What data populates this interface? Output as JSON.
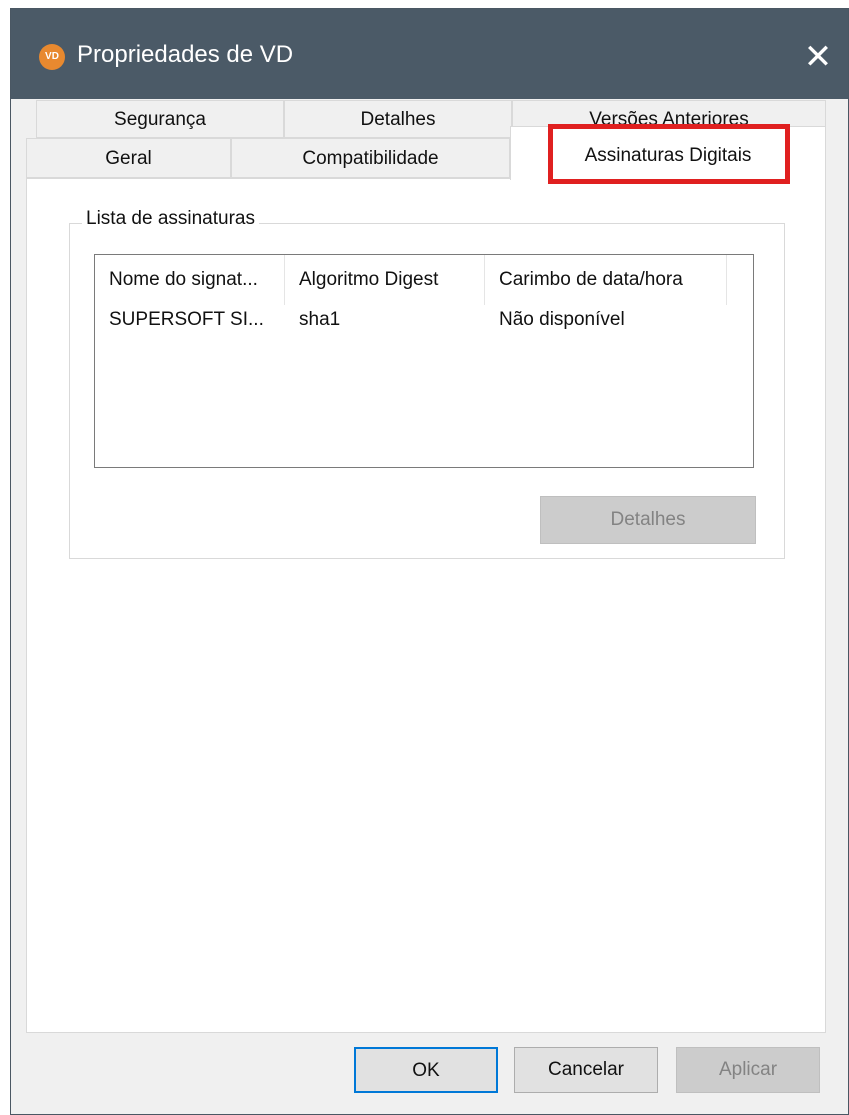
{
  "window": {
    "title": "Propriedades de VD",
    "icon_text": "VD",
    "close_glyph": "✕"
  },
  "tabs": {
    "row1": [
      "Segurança",
      "Detalhes",
      "Versões Anteriores"
    ],
    "row2": [
      "Geral",
      "Compatibilidade",
      "Assinaturas Digitais"
    ],
    "active": "Assinaturas Digitais",
    "highlight_color": "#e02020"
  },
  "signatures": {
    "group_label": "Lista de assinaturas",
    "columns": [
      "Nome do signat...",
      "Algoritmo Digest",
      "Carimbo de data/hora"
    ],
    "rows": [
      [
        "SUPERSOFT SI...",
        "sha1",
        "Não disponível"
      ]
    ],
    "details_button": "Detalhes"
  },
  "footer": {
    "ok": "OK",
    "cancel": "Cancelar",
    "apply": "Aplicar"
  }
}
